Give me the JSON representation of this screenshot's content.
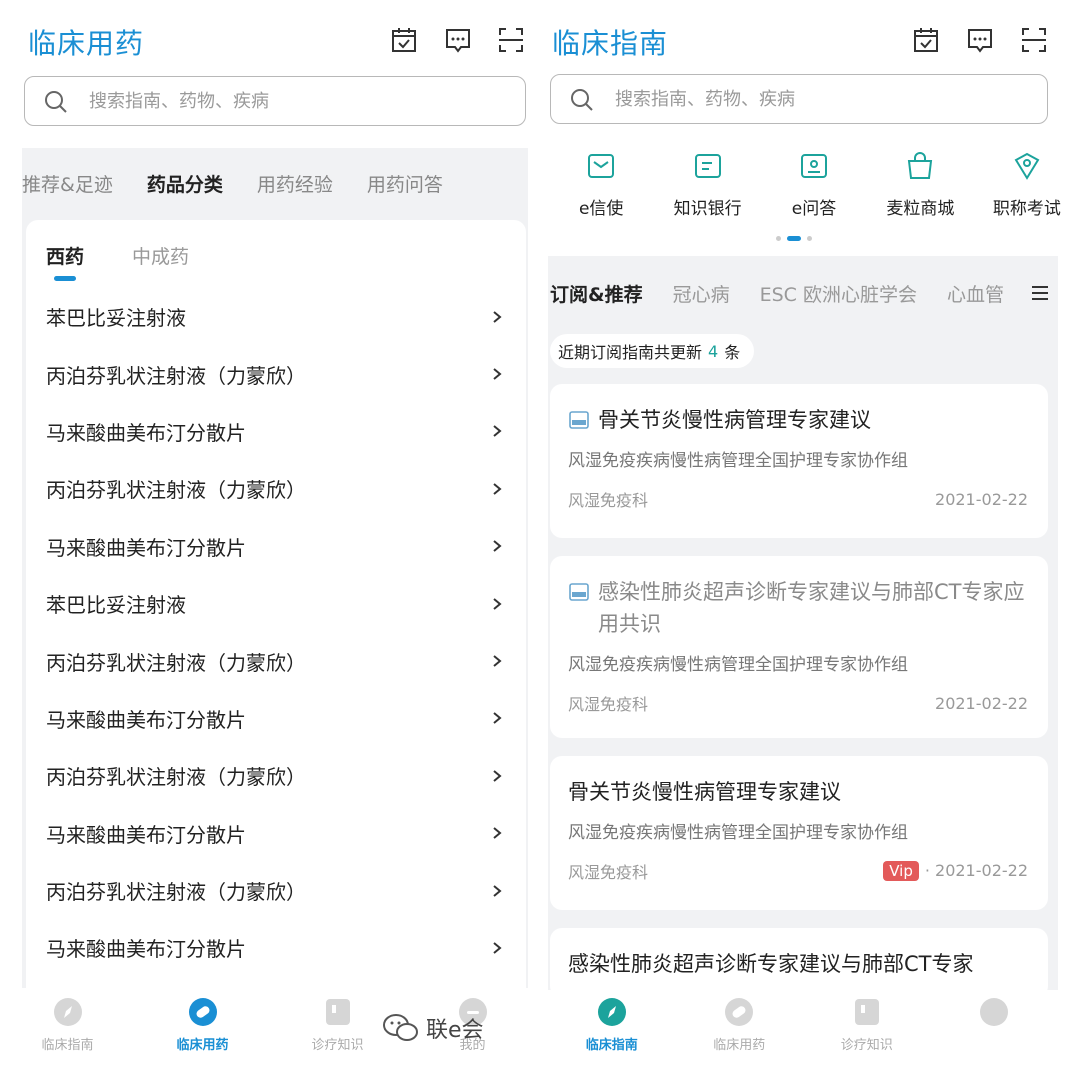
{
  "left": {
    "logo": "临床用药",
    "search_placeholder": "搜索指南、药物、疾病",
    "top_tabs": [
      "推荐&足迹",
      "药品分类",
      "用药经验",
      "用药问答"
    ],
    "sub_tabs": [
      "西药",
      "中成药"
    ],
    "drugs": [
      "苯巴比妥注射液",
      "丙泊芬乳状注射液（力蒙欣）",
      "马来酸曲美布汀分散片",
      "丙泊芬乳状注射液（力蒙欣）",
      "马来酸曲美布汀分散片",
      "苯巴比妥注射液",
      "丙泊芬乳状注射液（力蒙欣）",
      "马来酸曲美布汀分散片",
      "丙泊芬乳状注射液（力蒙欣）",
      "马来酸曲美布汀分散片",
      "丙泊芬乳状注射液（力蒙欣）",
      "马来酸曲美布汀分散片"
    ],
    "nav": [
      "临床指南",
      "临床用药",
      "诊疗知识",
      "我的"
    ]
  },
  "right": {
    "logo": "临床指南",
    "search_placeholder": "搜索指南、药物、疾病",
    "quick": [
      "e信使",
      "知识银行",
      "e问答",
      "麦粒商城",
      "职称考试"
    ],
    "cat_tabs": [
      "订阅&推荐",
      "冠心病",
      "ESC 欧洲心脏学会",
      "心血管"
    ],
    "update_prefix": "近期订阅指南共更新",
    "update_count": "4",
    "update_suffix": "条",
    "cards": [
      {
        "title": "骨关节炎慢性病管理专家建议",
        "org": "风湿免疫疾病慢性病管理全国护理专家协作组",
        "dept": "风湿免疫科",
        "date": "2021-02-22"
      },
      {
        "title": "感染性肺炎超声诊断专家建议与肺部CT专家应用共识",
        "org": "风湿免疫疾病慢性病管理全国护理专家协作组",
        "dept": "风湿免疫科",
        "date": "2021-02-22"
      },
      {
        "title": "骨关节炎慢性病管理专家建议",
        "org": "风湿免疫疾病慢性病管理全国护理专家协作组",
        "dept": "风湿免疫科",
        "vip": "Vip",
        "date": "· 2021-02-22"
      },
      {
        "title": "感染性肺炎超声诊断专家建议与肺部CT专家"
      }
    ],
    "nav": [
      "临床指南",
      "临床用药",
      "诊疗知识"
    ]
  },
  "watermark": "联e会",
  "colors": {
    "brand_blue": "#1a8fd4",
    "teal": "#1ca39c",
    "vip_red": "#e35a5a"
  }
}
